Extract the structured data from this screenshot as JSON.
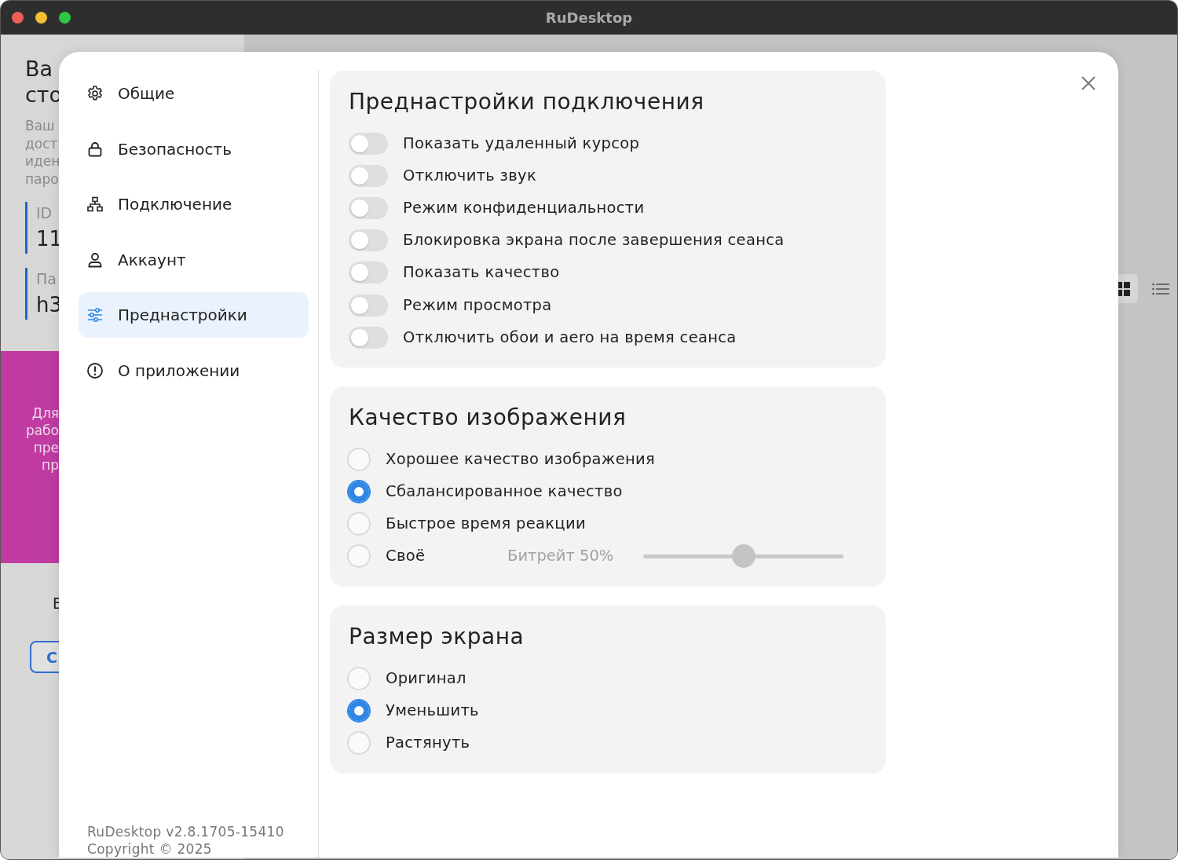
{
  "window": {
    "title": "RuDesktop"
  },
  "background": {
    "heading": [
      "Ва",
      "сто"
    ],
    "description": [
      "Ваш",
      "дост",
      "иден",
      "паро"
    ],
    "id": {
      "label": "ID",
      "value": "11"
    },
    "password": {
      "label": "Па",
      "value": "h3"
    },
    "banner": [
      "Для",
      "рабо",
      "пре",
      "пр"
    ],
    "status": "Е",
    "button": "С"
  },
  "sidebar": {
    "items": [
      {
        "kind": "general",
        "label": "Общие",
        "selected": false
      },
      {
        "kind": "security",
        "label": "Безопасность",
        "selected": false
      },
      {
        "kind": "connection",
        "label": "Подключение",
        "selected": false
      },
      {
        "kind": "account",
        "label": "Аккаунт",
        "selected": false
      },
      {
        "kind": "presets",
        "label": "Преднастройки",
        "selected": true
      },
      {
        "kind": "about",
        "label": "О приложении",
        "selected": false
      }
    ],
    "version": "RuDesktop v2.8.1705-15410",
    "copyright": "Copyright © 2025"
  },
  "sections": [
    {
      "kind": "toggles",
      "title": "Преднастройки подключения",
      "items": [
        {
          "label": "Показать удаленный курсор",
          "on": false
        },
        {
          "label": "Отключить звук",
          "on": false
        },
        {
          "label": "Режим конфиденциальности",
          "on": false
        },
        {
          "label": "Блокировка экрана после завершения сеанса",
          "on": false
        },
        {
          "label": "Показать качество",
          "on": false
        },
        {
          "label": "Режим просмотра",
          "on": false
        },
        {
          "label": "Отключить обои и aero на время сеанса",
          "on": false
        }
      ]
    },
    {
      "kind": "radios",
      "title": "Качество изображения",
      "items": [
        {
          "label": "Хорошее качество изображения",
          "selected": false
        },
        {
          "label": "Сбалансированное качество",
          "selected": true
        },
        {
          "label": "Быстрое время реакции",
          "selected": false
        },
        {
          "label": "Своё",
          "selected": false,
          "slider": {
            "label": "Битрейт 50%",
            "level": 0.5,
            "disabled": true
          }
        }
      ]
    },
    {
      "kind": "radios",
      "title": "Размер экрана",
      "items": [
        {
          "label": "Оригинал",
          "selected": false
        },
        {
          "label": "Уменьшить",
          "selected": true
        },
        {
          "label": "Растянуть",
          "selected": false
        }
      ]
    }
  ]
}
